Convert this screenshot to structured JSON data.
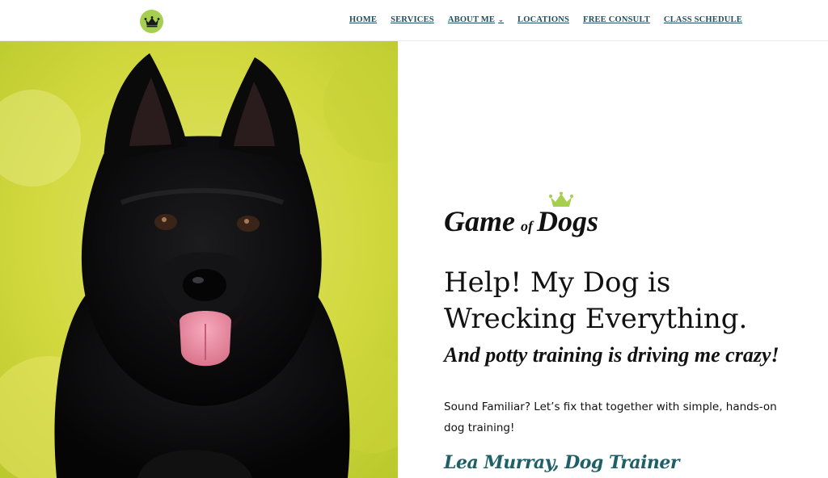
{
  "header": {
    "logo_icon": "crown-icon",
    "nav": [
      {
        "label": "HOME",
        "has_dropdown": false
      },
      {
        "label": "SERVICES",
        "has_dropdown": false
      },
      {
        "label": "ABOUT ME",
        "has_dropdown": true
      },
      {
        "label": "LOCATIONS",
        "has_dropdown": false
      },
      {
        "label": "FREE CONSULT",
        "has_dropdown": false
      },
      {
        "label": "CLASS SCHEDULE",
        "has_dropdown": false
      }
    ]
  },
  "hero": {
    "image_subject": "black dog with tongue out on yellow-green background",
    "brand": {
      "part1": "Game",
      "part2": "of",
      "part3": "Dogs",
      "crown_icon": "crown-icon"
    },
    "headline": "Help! My Dog is Wrecking Everything.",
    "subhead": "And potty training is driving me crazy!",
    "body": "Sound Familiar? Let’s fix that together with simple, hands-on dog training!",
    "signature": "Lea Murray, Dog Trainer"
  },
  "colors": {
    "accent_green": "#a6cf4f",
    "nav_teal": "#1f4e5f",
    "signature_teal": "#1e5f68",
    "hero_bg_yellow": "#d9dc3c"
  }
}
